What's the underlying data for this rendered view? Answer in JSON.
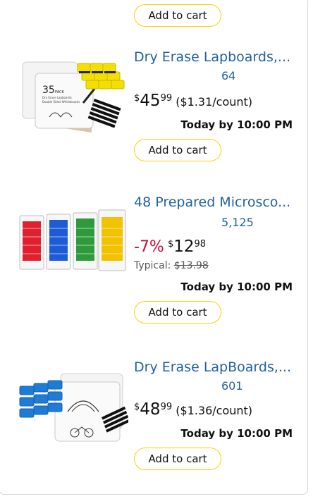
{
  "products": [
    {
      "button": "Add to cart"
    },
    {
      "title": "Dry Erase Lapboards,...",
      "rating_count": "64",
      "price_symbol": "$",
      "price_whole": "45",
      "price_fraction": "99",
      "unit_price": "($1.31/count)",
      "delivery": "Today by 10:00 PM",
      "button": "Add to cart",
      "image_text": "35 PACK"
    },
    {
      "title": "48 Prepared Microsco...",
      "rating_count": "5,125",
      "discount": "-7%",
      "price_symbol": "$",
      "price_whole": "12",
      "price_fraction": "98",
      "typical_label": "Typical:",
      "typical_price": "$13.98",
      "delivery": "Today by 10:00 PM",
      "button": "Add to cart"
    },
    {
      "title": "Dry Erase LapBoards,...",
      "rating_count": "601",
      "price_symbol": "$",
      "price_whole": "48",
      "price_fraction": "99",
      "unit_price": "($1.36/count)",
      "delivery": "Today by 10:00 PM",
      "button": "Add to cart"
    }
  ],
  "colors": {
    "link": "#2162a1",
    "discount": "#cc0c39",
    "button_border": "#fcd200"
  }
}
